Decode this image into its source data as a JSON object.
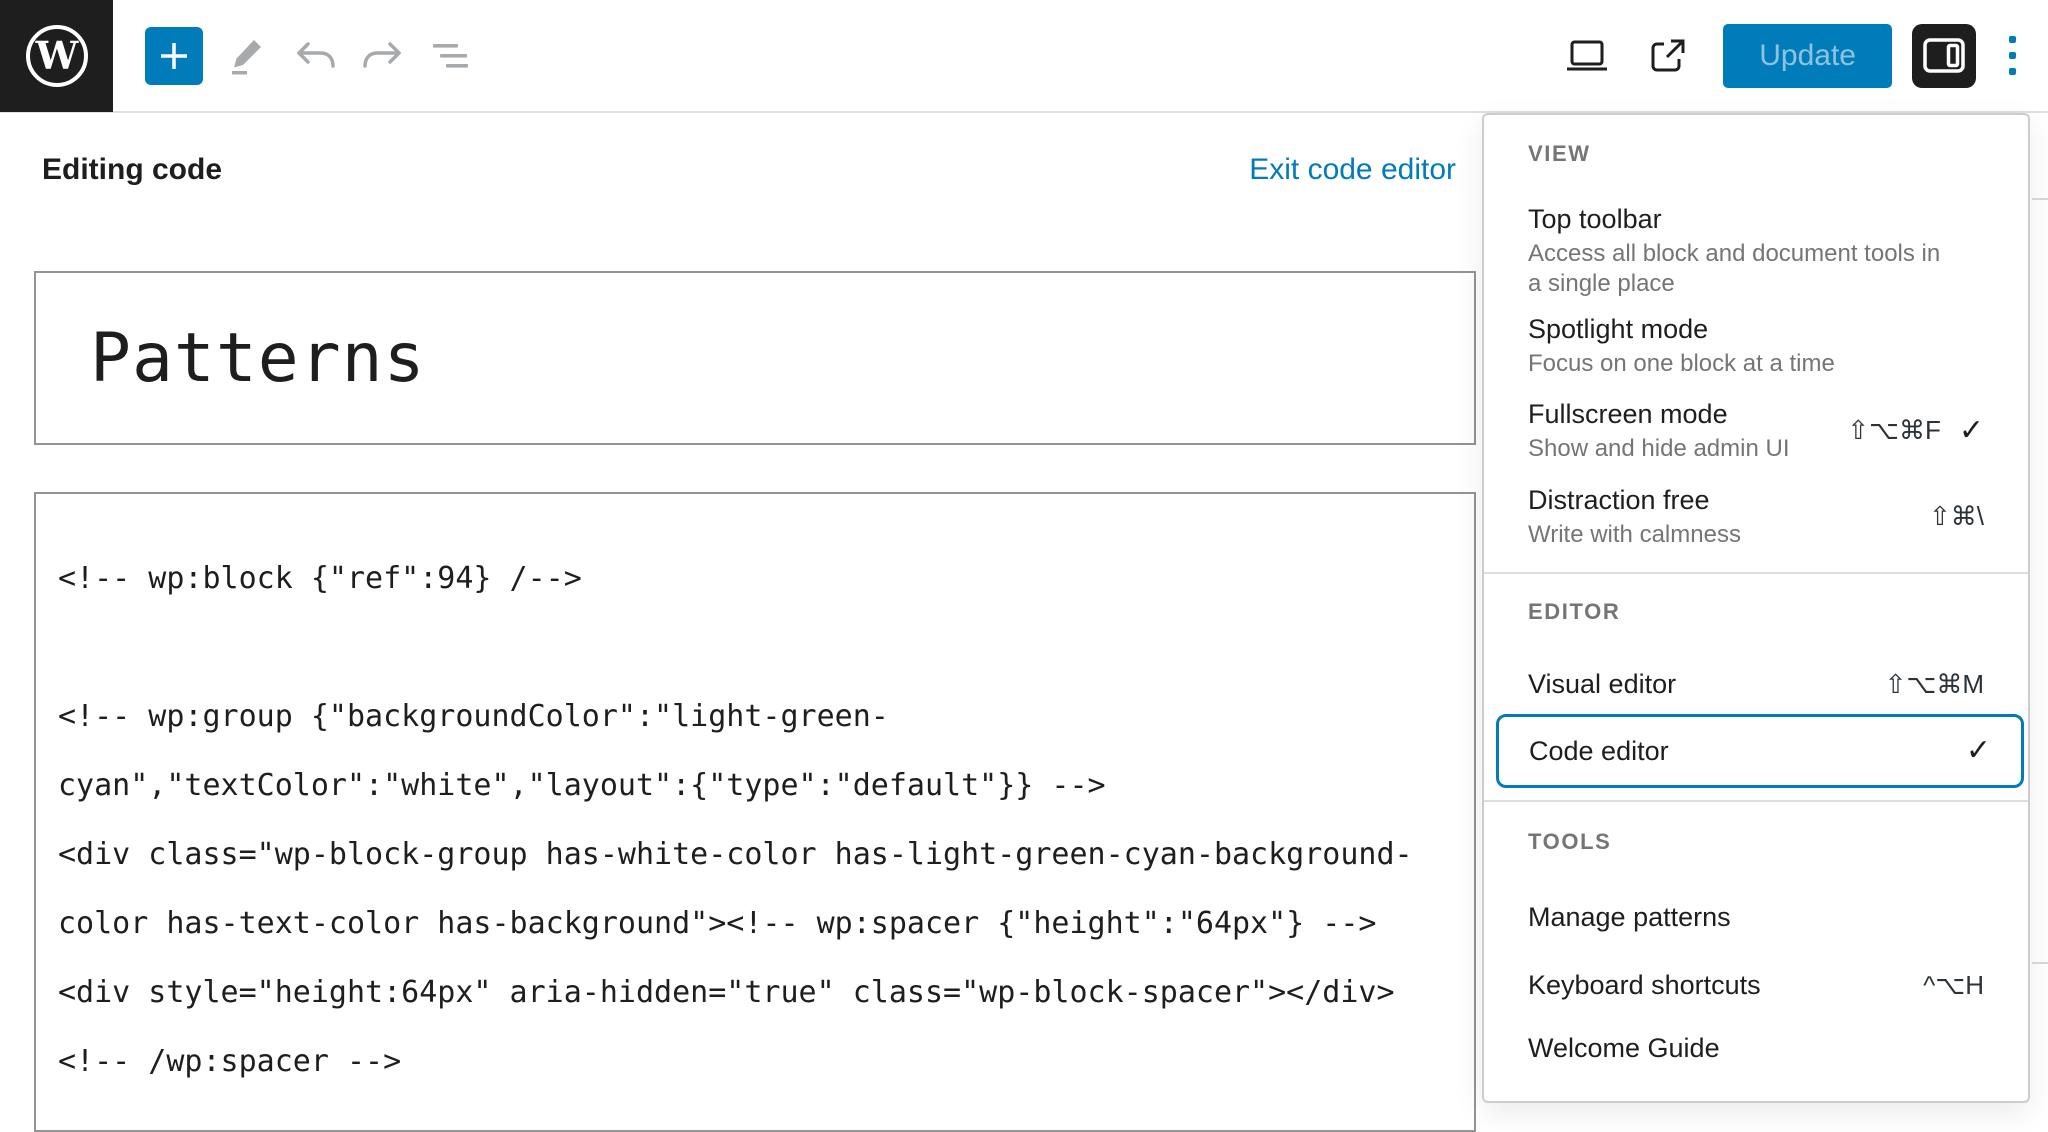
{
  "colors": {
    "accent": "#007cba",
    "toolbar_black": "#1e1e1e",
    "disabled_icon": "#a7aaad"
  },
  "topbar": {
    "update_label": "Update"
  },
  "content": {
    "editing_label": "Editing code",
    "exit_link_label": "Exit code editor",
    "title_value": "Patterns",
    "code_lines": [
      "<!-- wp:block {\"ref\":94} /-->",
      "",
      "<!-- wp:group {\"backgroundColor\":\"light-green-",
      "cyan\",\"textColor\":\"white\",\"layout\":{\"type\":\"default\"}} -->",
      "<div class=\"wp-block-group has-white-color has-light-green-cyan-background-",
      "color has-text-color has-background\"><!-- wp:spacer {\"height\":\"64px\"} -->",
      "<div style=\"height:64px\" aria-hidden=\"true\" class=\"wp-block-spacer\"></div>",
      "<!-- /wp:spacer -->"
    ]
  },
  "menu": {
    "sections": [
      {
        "title": "VIEW",
        "items": [
          {
            "label": "Top toolbar",
            "help": "Access all block and document tools in a single place"
          },
          {
            "label": "Spotlight mode",
            "help": "Focus on one block at a time"
          },
          {
            "label": "Fullscreen mode",
            "help": "Show and hide admin UI",
            "shortcut": "⇧⌥⌘F",
            "check": "✓"
          },
          {
            "label": "Distraction free",
            "help": "Write with calmness",
            "shortcut": "⇧⌘\\"
          }
        ]
      },
      {
        "title": "EDITOR",
        "items": [
          {
            "label": "Visual editor",
            "shortcut": "⇧⌥⌘M"
          },
          {
            "label": "Code editor",
            "check": "✓"
          }
        ]
      },
      {
        "title": "TOOLS",
        "items": [
          {
            "label": "Manage patterns"
          },
          {
            "label": "Keyboard shortcuts",
            "shortcut": "^⌥H"
          },
          {
            "label": "Welcome Guide"
          }
        ]
      }
    ]
  }
}
